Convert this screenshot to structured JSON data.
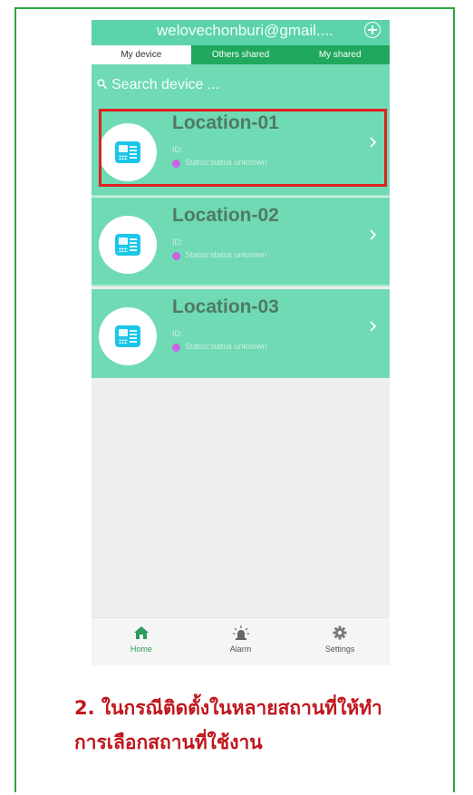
{
  "header": {
    "email": "welovechonburi@gmail....",
    "add_icon": "circle-plus-icon"
  },
  "tabs": [
    {
      "label": "My device",
      "active": true
    },
    {
      "label": "Others shared",
      "active": false
    },
    {
      "label": "My shared",
      "active": false
    }
  ],
  "search": {
    "placeholder": "Search device ..."
  },
  "devices": [
    {
      "name": "Location-01",
      "id_label": "ID:",
      "status": "Status:status unknown"
    },
    {
      "name": "Location-02",
      "id_label": "ID:",
      "status": "Status:status unknown"
    },
    {
      "name": "Location-03",
      "id_label": "ID:",
      "status": "Status:status unknown"
    }
  ],
  "bottom_nav": [
    {
      "label": "Home",
      "icon": "home-icon",
      "active": true
    },
    {
      "label": "Alarm",
      "icon": "alarm-siren-icon",
      "active": false
    },
    {
      "label": "Settings",
      "icon": "gear-icon",
      "active": false
    }
  ],
  "caption": {
    "number": "2.",
    "line1": " ในกรณีติดตั้งในหลายสถานที่ให้ทำ",
    "line2": "การเลือกสถานที่ใช้งาน"
  },
  "colors": {
    "accent": "#5cd3a9",
    "card": "#6fdab3",
    "tab_inactive": "#1fa85e",
    "highlight": "#e02020",
    "caption": "#c0151b",
    "status_dot": "#c964e6"
  }
}
